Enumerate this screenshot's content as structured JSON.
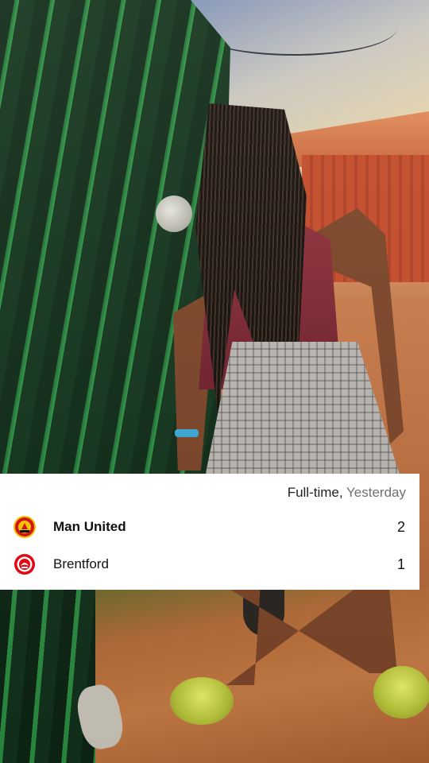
{
  "match": {
    "status": "Full-time,",
    "when": "Yesterday",
    "home": {
      "name": "Man United",
      "score": "2",
      "crest_icon": "man-united-crest-icon"
    },
    "away": {
      "name": "Brentford",
      "score": "1",
      "crest_icon": "brentford-crest-icon"
    }
  },
  "colors": {
    "card_background": "#ffffff",
    "muted_text": "#707070",
    "home_crest": "#d2141d",
    "away_crest": "#e30613"
  }
}
